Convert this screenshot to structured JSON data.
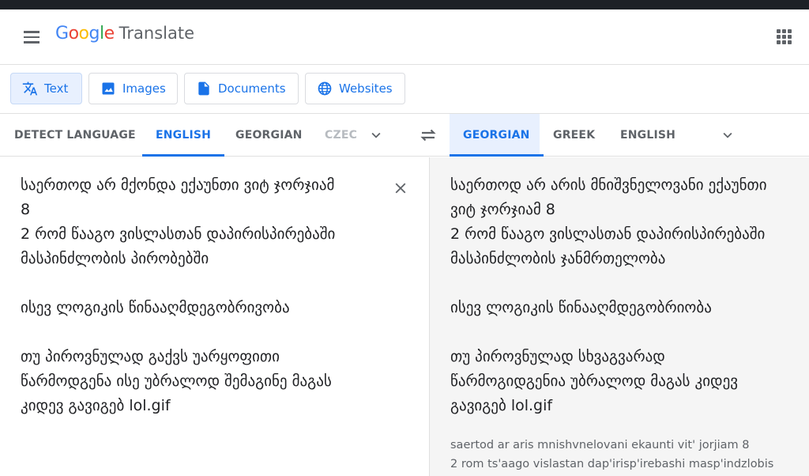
{
  "app": {
    "brand": "Google",
    "product": "Translate"
  },
  "icons": {
    "menu": "menu-icon",
    "apps": "apps-grid-icon",
    "text_mode": "translate-icon",
    "images_mode": "image-icon",
    "documents_mode": "document-icon",
    "websites_mode": "globe-icon",
    "swap": "swap-languages-icon",
    "clear": "close-icon",
    "more_languages": "chevron-down-icon"
  },
  "modes": {
    "text": "Text",
    "images": "Images",
    "documents": "Documents",
    "websites": "Websites"
  },
  "source_languages": {
    "detect": "DETECT LANGUAGE",
    "english": "ENGLISH",
    "georgian": "GEORGIAN",
    "czech_partial": "CZEC"
  },
  "target_languages": {
    "georgian": "GEORGIAN",
    "greek": "GREEK",
    "english": "ENGLISH"
  },
  "source": {
    "text": "საერთოდ არ მქონდა ექაუნთი ვიტ ჯორჯიამ\n8\n2 რომ წააგო ვისლასთან დაპირისპირებაში\nმასპინძლობის პირობებში\n\nისევ ლოგიკის წინააღმდეგობრივობა\n\nთუ პიროვნულად გაქვს უარყოფითი\nწარმოდგენა ისე უბრალოდ შემაგინე მაგას\nკიდევ გავიგებ lol.gif"
  },
  "translation": {
    "text": "საერთოდ არ არის მნიშვნელოვანი ექაუნთი\nვიტ ჯორჯიამ 8\n2 რომ წააგო ვისლასთან დაპირისპირებაში\nმასპინძლობის ჯანმრთელობა\n\nისევ ლოგიკის წინააღმდეგობრიობა\n\nთუ პიროვნულად სხვაგვარად\nწარმოგიდგენია უბრალოდ მაგას კიდევ\nგავიგებ lol.gif",
    "transliteration": "saertod ar aris mnishvnelovani ekaunti vit' jorjiam 8\n2 rom ts'aago vislastan dap'irisp'irebashi masp'indzlobis"
  },
  "colors": {
    "accent": "#1a73e8",
    "google_blue": "#4285F4",
    "google_red": "#EA4335",
    "google_yellow": "#FBBC05",
    "google_green": "#34A853"
  }
}
